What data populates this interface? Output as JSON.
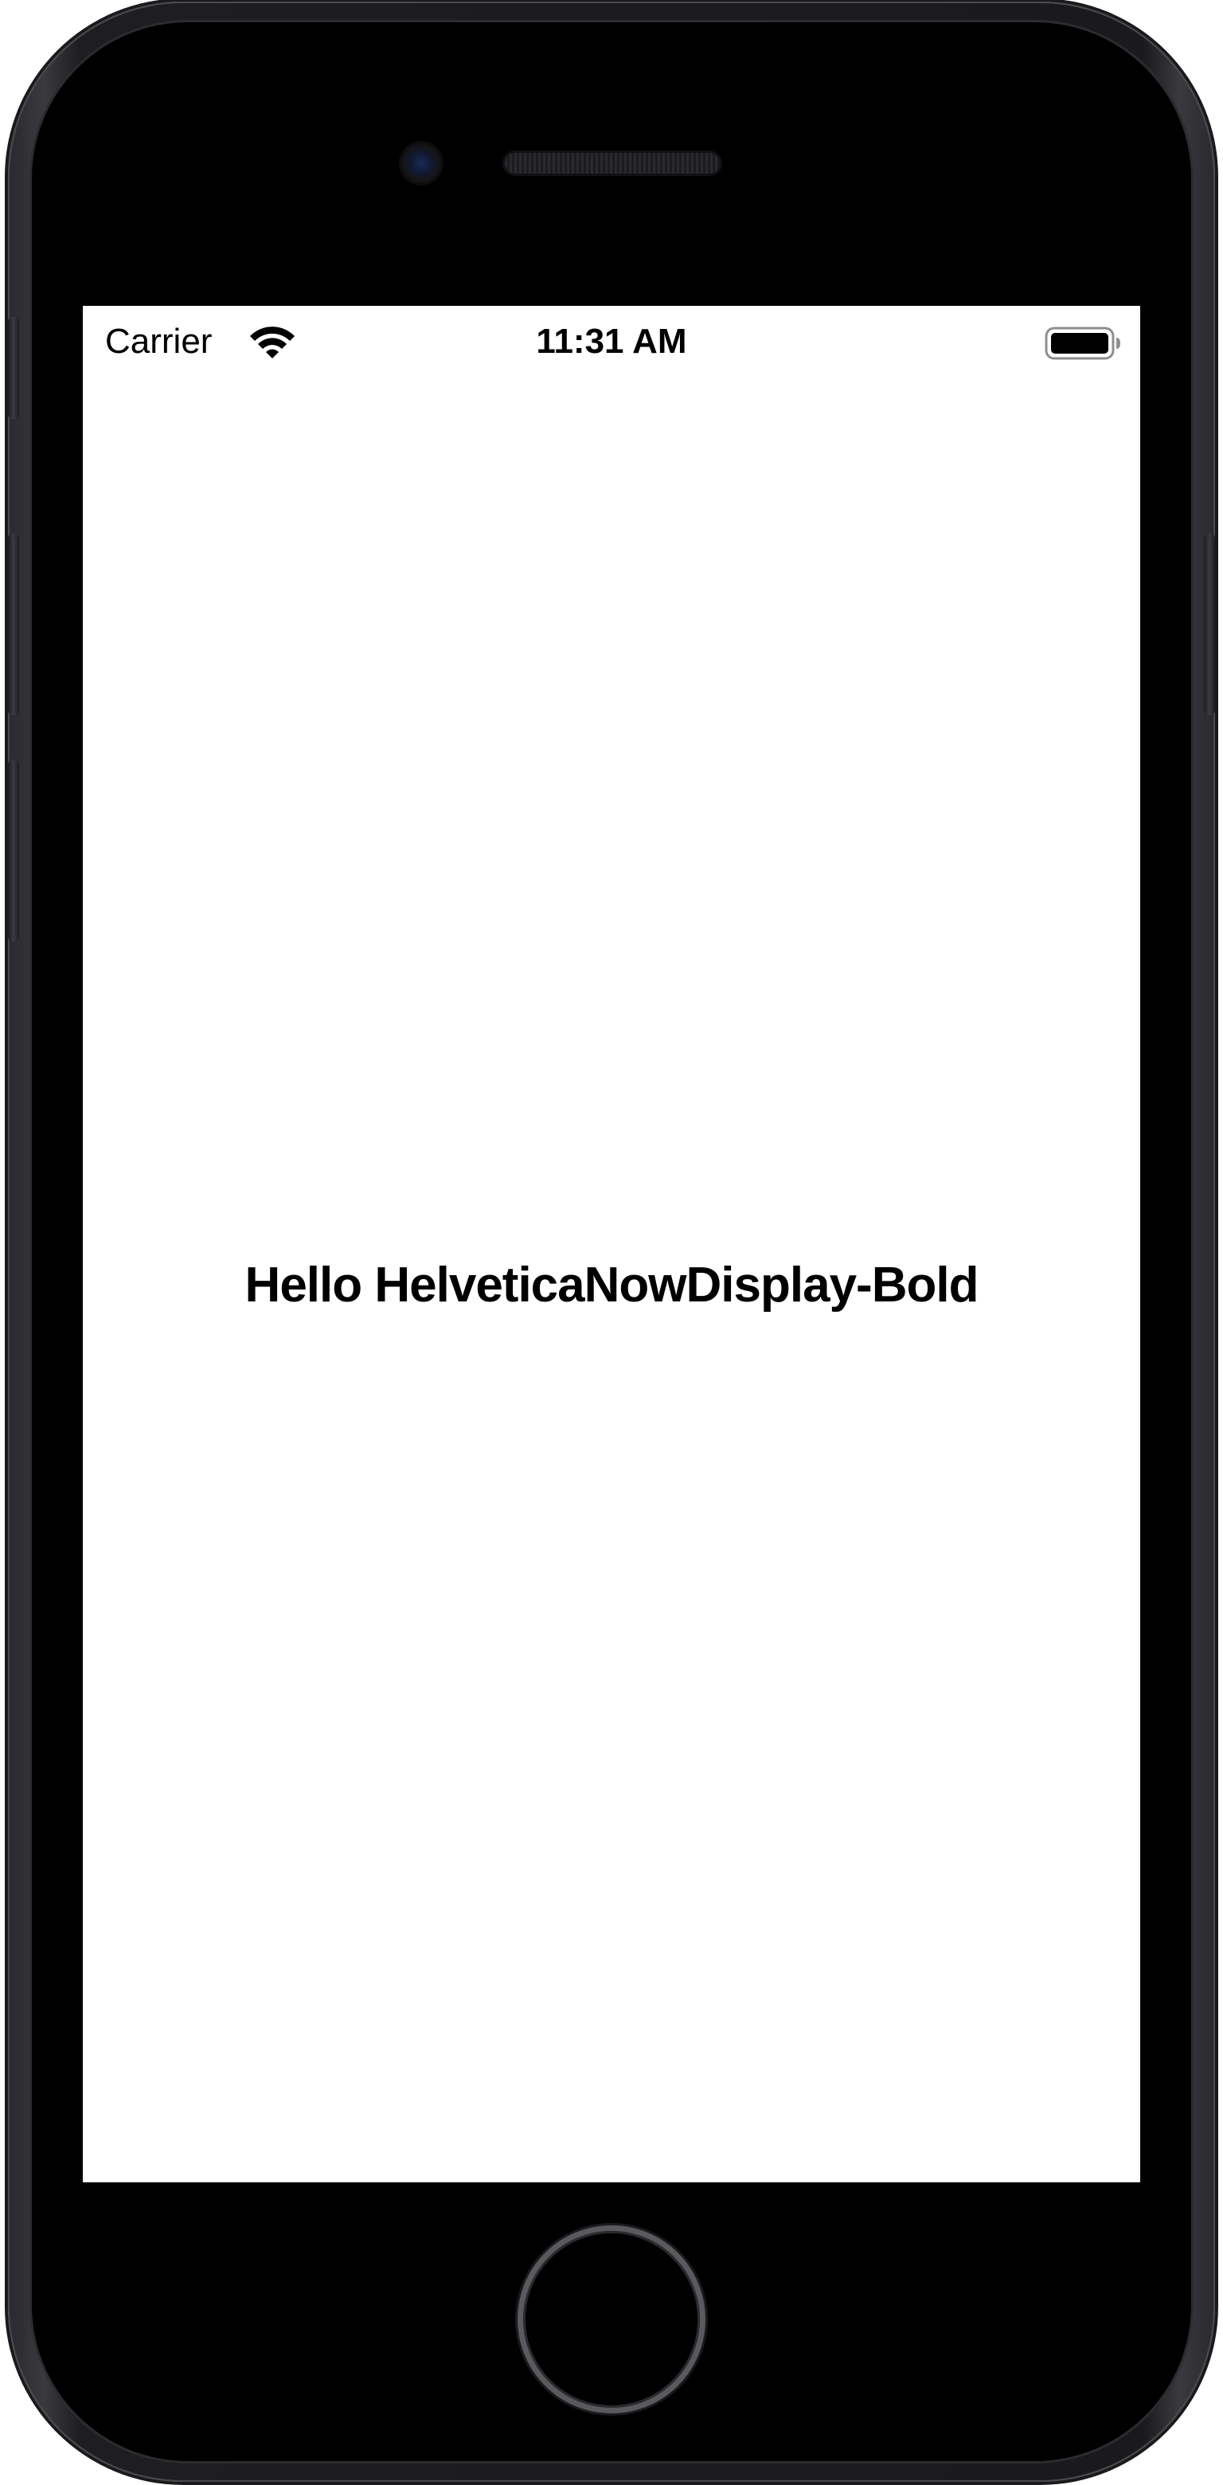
{
  "status_bar": {
    "carrier": "Carrier",
    "time": "11:31 AM",
    "wifi_icon": "wifi-icon",
    "battery_icon": "battery-full-icon"
  },
  "main": {
    "label": "Hello HelveticaNowDisplay-Bold"
  },
  "colors": {
    "screen_background": "#ffffff",
    "text": "#000000",
    "device_frame": "#1e1e21"
  }
}
